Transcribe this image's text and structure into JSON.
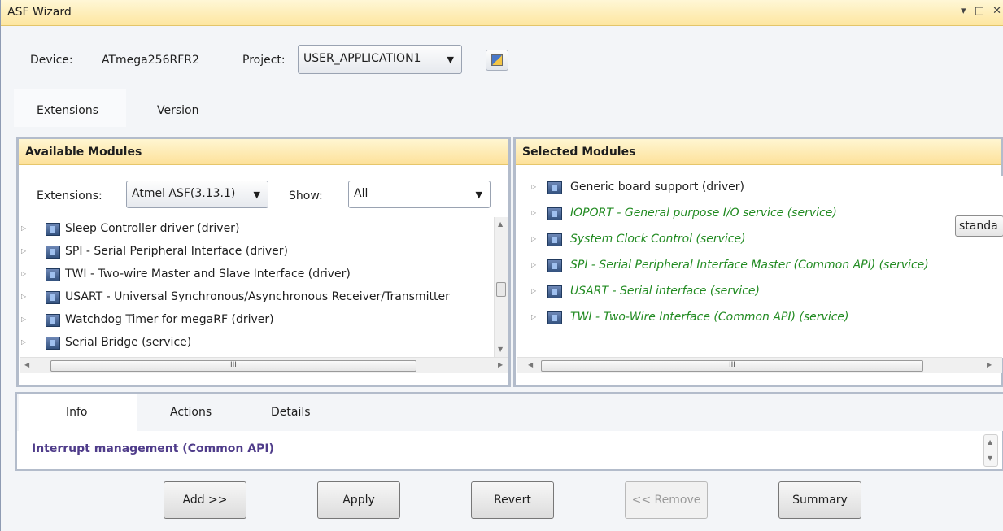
{
  "window": {
    "title": "ASF Wizard",
    "controls": "▾ □ ✕"
  },
  "header": {
    "device_label": "Device:",
    "device_value": "ATmega256RFR2",
    "project_label": "Project:",
    "project_value": "USER_APPLICATION1",
    "icon": "project-properties-icon"
  },
  "top_tabs": [
    {
      "label": "Extensions",
      "active": true
    },
    {
      "label": "Version",
      "active": false
    }
  ],
  "available": {
    "title": "Available Modules",
    "extensions_label": "Extensions:",
    "extensions_value": "Atmel ASF(3.13.1)",
    "show_label": "Show:",
    "show_value": "All",
    "items": [
      "Sleep Controller driver (driver)",
      "SPI - Serial Peripheral Interface (driver)",
      "TWI - Two-wire Master and Slave Interface (driver)",
      "USART - Universal Synchronous/Asynchronous Receiver/Transmitter",
      "Watchdog Timer for megaRF (driver)",
      "Serial Bridge  (service)"
    ]
  },
  "selected": {
    "title": "Selected Modules",
    "items": [
      {
        "label": "Generic board support (driver)",
        "green": false
      },
      {
        "label": "IOPORT - General purpose I/O service (service)",
        "green": true
      },
      {
        "label": "System Clock Control (service)",
        "green": true
      },
      {
        "label": "SPI - Serial Peripheral Interface Master (Common API) (service)",
        "green": true
      },
      {
        "label": "USART - Serial interface (service)",
        "green": true
      },
      {
        "label": "TWI - Two-Wire Interface (Common API) (service)",
        "green": true
      }
    ],
    "spi_option": "standa"
  },
  "info": {
    "tabs": [
      "Info",
      "Actions",
      "Details"
    ],
    "text": "Interrupt management (Common API)"
  },
  "buttons": {
    "add": "Add >>",
    "apply": "Apply",
    "revert": "Revert",
    "remove": "<< Remove",
    "summary": "Summary"
  },
  "colors": {
    "header_gradient": "#fde19a",
    "green_text": "#228b22",
    "info_text": "#4f3c8a"
  }
}
